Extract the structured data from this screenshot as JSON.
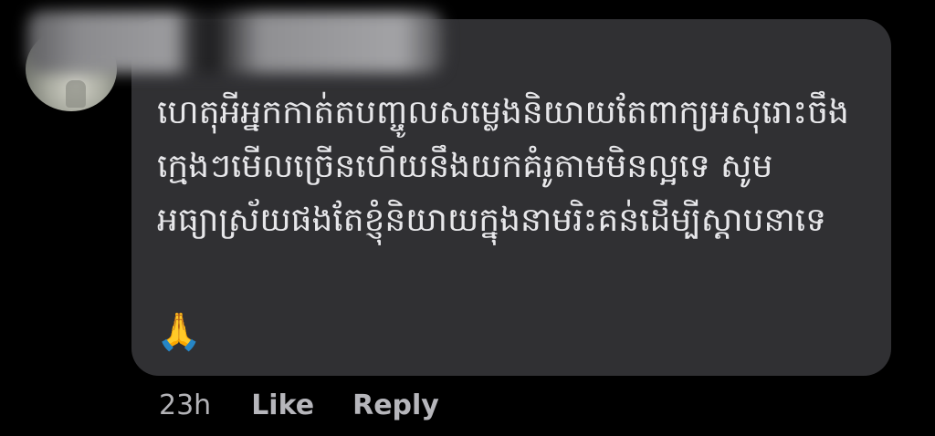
{
  "comment": {
    "text": "ហេតុអីអ្នកកាត់តបញ្ចូលសម្លេងនិយាយតែពាក្យអសុរោះចឹង\nក្មេងៗមើលច្រើនហើយនឹងយកគំរូតាមមិនល្អទេ សូម\nអធ្យាស្រ័យផងតែខ្ញុំនិយាយក្នុងនាមរិះគន់ដើម្បីស្តាបនាទេ",
    "emoji": "🙏",
    "emoji_icon": "folded-hands-icon"
  },
  "actions": {
    "time": "23h",
    "like_label": "Like",
    "reply_label": "Reply"
  },
  "colors": {
    "background": "#000000",
    "bubble": "#303033",
    "text": "#e7e7ea",
    "action_text": "#b6b6bb"
  }
}
